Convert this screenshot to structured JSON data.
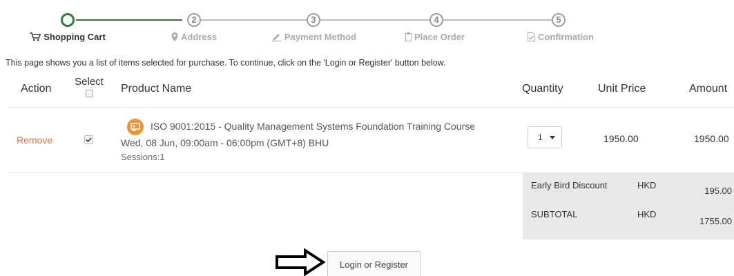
{
  "steps": [
    {
      "number": "",
      "label": "Shopping Cart",
      "icon": "cart-icon"
    },
    {
      "number": "2",
      "label": "Address",
      "icon": "map-marker-icon"
    },
    {
      "number": "3",
      "label": "Payment Method",
      "icon": "pencil-icon"
    },
    {
      "number": "4",
      "label": "Place Order",
      "icon": "clipboard-icon"
    },
    {
      "number": "5",
      "label": "Confirmation",
      "icon": "document-check-icon"
    }
  ],
  "info_text": "This page shows you a list of items selected for purchase. To continue, click on the 'Login or Register' button below.",
  "table": {
    "headers": {
      "action": "Action",
      "select": "Select",
      "product": "Product Name",
      "quantity": "Quantity",
      "unit_price": "Unit Price",
      "amount": "Amount"
    },
    "rows": [
      {
        "action": "Remove",
        "selected": true,
        "title": "ISO 9001:2015 - Quality Management Systems Foundation Training Course",
        "date": "Wed, 08 Jun, 09:00am - 06:00pm (GMT+8) BHU",
        "sessions": "Sessions:1",
        "quantity": "1",
        "unit_price": "1950.00",
        "amount": "1950.00"
      }
    ]
  },
  "summary": {
    "discount_label": "Early Bird Discount",
    "discount_currency": "HKD",
    "discount_value": "195.00",
    "subtotal_label": "SUBTOTAL",
    "subtotal_currency": "HKD",
    "subtotal_value": "1755.00"
  },
  "login_button": "Login or Register",
  "colors": {
    "active_step": "#2e7d32",
    "remove_link": "#e8703a",
    "course_icon": "#f39231",
    "summary_bg": "#e9e9e9"
  }
}
